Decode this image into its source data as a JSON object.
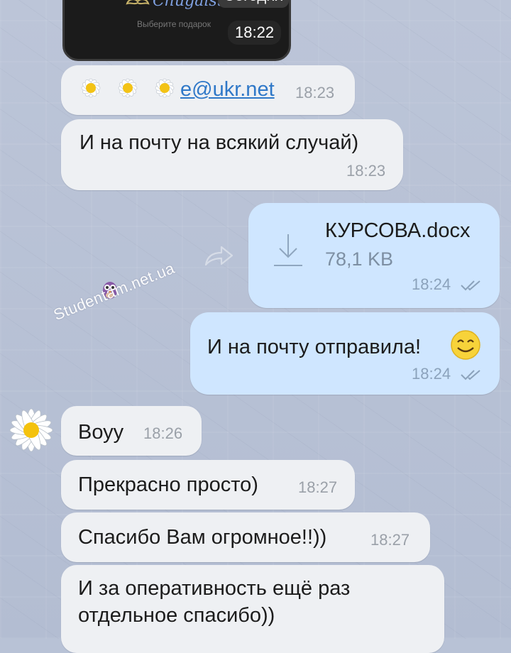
{
  "header": {
    "logo_text": "Chugaister",
    "logo_subtitle": "Выберите подарок",
    "date_label": "Сегодня",
    "image_time": "18:22"
  },
  "messages": [
    {
      "direction": "in",
      "email": "e@ukr.net",
      "time": "18:23"
    },
    {
      "direction": "in",
      "text": "И на почту на всякий случай)",
      "time": "18:23"
    },
    {
      "direction": "out",
      "file_name": "КУРСОВА.docx",
      "file_size": "78,1 KB",
      "time": "18:24"
    },
    {
      "direction": "out",
      "text": "И на почту отправила!",
      "time": "18:24"
    },
    {
      "direction": "in",
      "text": "Воуу",
      "time": "18:26"
    },
    {
      "direction": "in",
      "text": "Прекрасно просто)",
      "time": "18:27"
    },
    {
      "direction": "in",
      "text": "Спасибо Вам огромное!!))",
      "time": "18:27"
    },
    {
      "direction": "in",
      "text_line1": "И за оперативность ещё раз",
      "text_line2": "отдельное спасибо))"
    }
  ],
  "watermark": "Studentam.net.ua",
  "colors": {
    "incoming_bubble": "#eef0f3",
    "outgoing_bubble": "#cfe6ff",
    "link": "#2f78c8",
    "background": "#b8c2d6"
  },
  "icons": [
    "download-icon",
    "read-checks-icon",
    "forward-icon",
    "daisy-emoji",
    "smiley-emoji",
    "owl-icon",
    "avatar"
  ]
}
